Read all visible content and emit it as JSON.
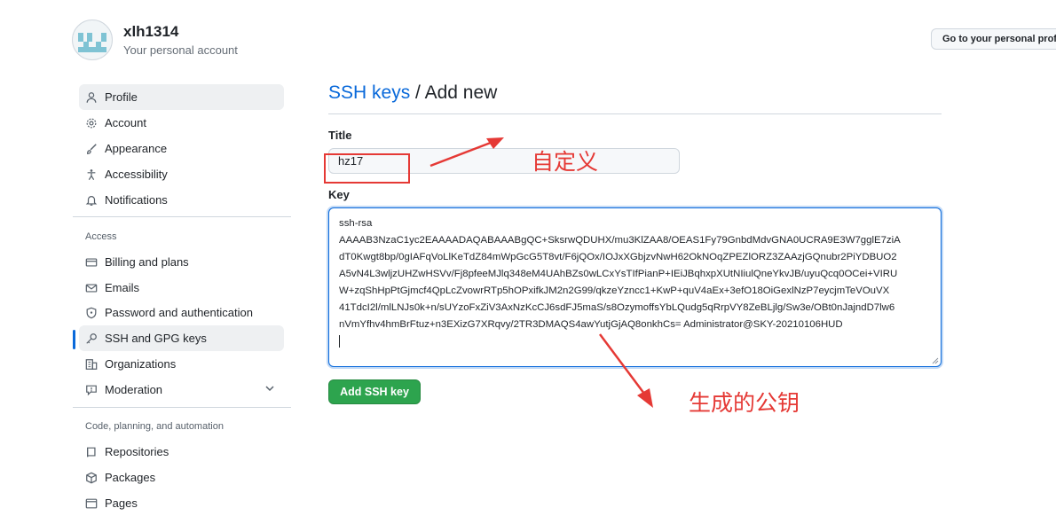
{
  "header": {
    "username": "xlh1314",
    "account_subtitle": "Your personal account",
    "go_to_profile_label": "Go to your personal profile"
  },
  "sidebar": {
    "items": [
      {
        "label": "Profile",
        "icon": "person-icon"
      },
      {
        "label": "Account",
        "icon": "gear-icon"
      },
      {
        "label": "Appearance",
        "icon": "paintbrush-icon"
      },
      {
        "label": "Accessibility",
        "icon": "accessibility-icon"
      },
      {
        "label": "Notifications",
        "icon": "bell-icon"
      }
    ],
    "access_label": "Access",
    "access_items": [
      {
        "label": "Billing and plans",
        "icon": "credit-card-icon"
      },
      {
        "label": "Emails",
        "icon": "mail-icon"
      },
      {
        "label": "Password and authentication",
        "icon": "shield-lock-icon"
      },
      {
        "label": "SSH and GPG keys",
        "icon": "key-icon",
        "selected": true
      },
      {
        "label": "Organizations",
        "icon": "organization-icon"
      },
      {
        "label": "Moderation",
        "icon": "report-icon"
      }
    ],
    "code_label": "Code, planning, and automation",
    "code_items": [
      {
        "label": "Repositories",
        "icon": "repo-icon"
      },
      {
        "label": "Packages",
        "icon": "package-icon"
      },
      {
        "label": "Pages",
        "icon": "browser-icon"
      }
    ]
  },
  "main": {
    "breadcrumb_link": "SSH keys",
    "breadcrumb_separator": "/",
    "breadcrumb_current": "Add new",
    "title_label": "Title",
    "title_value": "hz17",
    "key_label": "Key",
    "key_lines": [
      "ssh-rsa",
      "AAAAB3NzaC1yc2EAAAADAQABAAABgQC+SksrwQDUHX/mu3KlZAA8/OEAS1Fy79GnbdMdvGNA0UCRA9E3W7gglE7ziA",
      "dT0Kwgt8bp/0gIAFqVoLlKeTdZ84mWpGcG5T8vt/F6jQOx/IOJxXGbjzvNwH62OkNOqZPEZlORZ3ZAAzjGQnubr2PiYDBUO2",
      "A5vN4L3wljzUHZwHSVv/Fj8pfeeMJlq348eM4UAhBZs0wLCxYsTIfPianP+IEiJBqhxpXUtNIiulQneYkvJB/uyuQcq0OCei+VIRU",
      "W+zqShHpPtGjmcf4QpLcZvowrRTp5hOPxifkJM2n2G99/qkzeYzncc1+KwP+quV4aEx+3efO18OiGexlNzP7eycjmTeVOuVX",
      "41TdcI2l/mlLNJs0k+n/sUYzoFxZiV3AxNzKcCJ6sdFJ5maS/s8OzymoffsYbLQudg5qRrpVY8ZeBLjlg/Sw3e/OBt0nJajndD7lw6",
      "nVmYfhv4hmBrFtuz+n3EXizG7XRqvy/2TR3DMAQS4awYutjGjAQ8onkhCs= Administrator@SKY-20210106HUD"
    ],
    "add_button_label": "Add SSH key"
  },
  "annotations": {
    "title_note": "自定义",
    "key_note": "生成的公钥",
    "color": "#e53935"
  },
  "colors": {
    "accent": "#0969da",
    "primary_button": "#2da44e"
  }
}
